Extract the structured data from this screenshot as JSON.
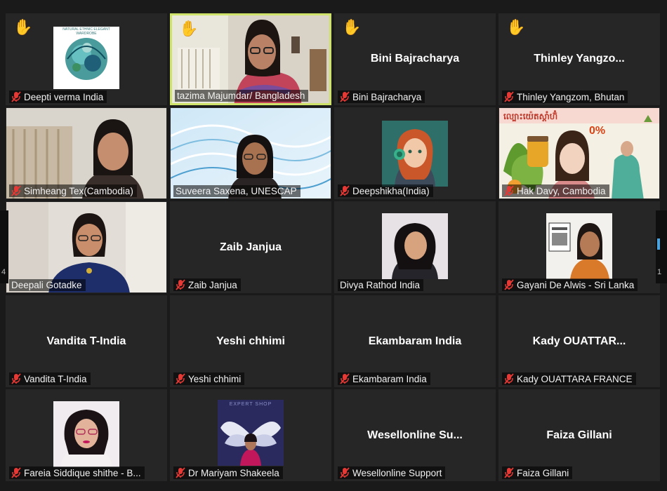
{
  "pager": {
    "left_num": "4",
    "right_num": "1"
  },
  "tiles": [
    {
      "label": "Deepti verma India",
      "big": "",
      "hand": true,
      "muted": true
    },
    {
      "label": "tazima Majumdar/ Bangladesh",
      "big": "",
      "hand": true,
      "muted": false
    },
    {
      "label": "Bini Bajracharya",
      "big": "Bini Bajracharya",
      "hand": true,
      "muted": true
    },
    {
      "label": "Thinley Yangzom, Bhutan",
      "big": "Thinley  Yangzo...",
      "hand": true,
      "muted": true
    },
    {
      "label": "Simheang Tex(Cambodia)",
      "big": "",
      "hand": false,
      "muted": true
    },
    {
      "label": "Suveera Saxena, UNESCAP",
      "big": "",
      "hand": false,
      "muted": false
    },
    {
      "label": "Deepshikha(India)",
      "big": "",
      "hand": false,
      "muted": true
    },
    {
      "label": "Hak Davy, Cambodia",
      "big": "",
      "hand": false,
      "muted": true
    },
    {
      "label": "Deepali Gotadke",
      "big": "",
      "hand": false,
      "muted": false
    },
    {
      "label": "Zaib Janjua",
      "big": "Zaib Janjua",
      "hand": false,
      "muted": true
    },
    {
      "label": "Divya Rathod India",
      "big": "",
      "hand": false,
      "muted": false
    },
    {
      "label": "Gayani De Alwis - Sri Lanka",
      "big": "",
      "hand": false,
      "muted": true
    },
    {
      "label": "Vandita T-India",
      "big": "Vandita T-India",
      "hand": false,
      "muted": true
    },
    {
      "label": "Yeshi chhimi",
      "big": "Yeshi chhimi",
      "hand": false,
      "muted": true
    },
    {
      "label": "Ekambaram India",
      "big": "Ekambaram India",
      "hand": false,
      "muted": true
    },
    {
      "label": "Kady OUATTARA FRANCE",
      "big": "Kady  OUATTAR...",
      "hand": false,
      "muted": true
    },
    {
      "label": "Fareia Siddique shithe  - B...",
      "big": "",
      "hand": false,
      "muted": true
    },
    {
      "label": "Dr Mariyam Shakeela",
      "big": "",
      "hand": false,
      "muted": true
    },
    {
      "label": "Wesellonline Support",
      "big": "Wesellonline  Su...",
      "hand": false,
      "muted": true
    },
    {
      "label": "Faiza Gillani",
      "big": "Faiza Gillani",
      "hand": false,
      "muted": true
    }
  ],
  "logo_texts": {
    "deepti": "NATURAL ETHNIC ELEGANT WARDROBE",
    "hak_banner": "ល្បោះយ៉េតស្តាំហ៊ំ",
    "hak_percent": "0%",
    "mariyam_sign": "EXPERT SHOP"
  },
  "colors": {
    "background": "#1a1a1a",
    "tile": "#262626",
    "active_border": "#cfe26a",
    "mic_muted": "#e53935",
    "hand": "#f4b400"
  }
}
